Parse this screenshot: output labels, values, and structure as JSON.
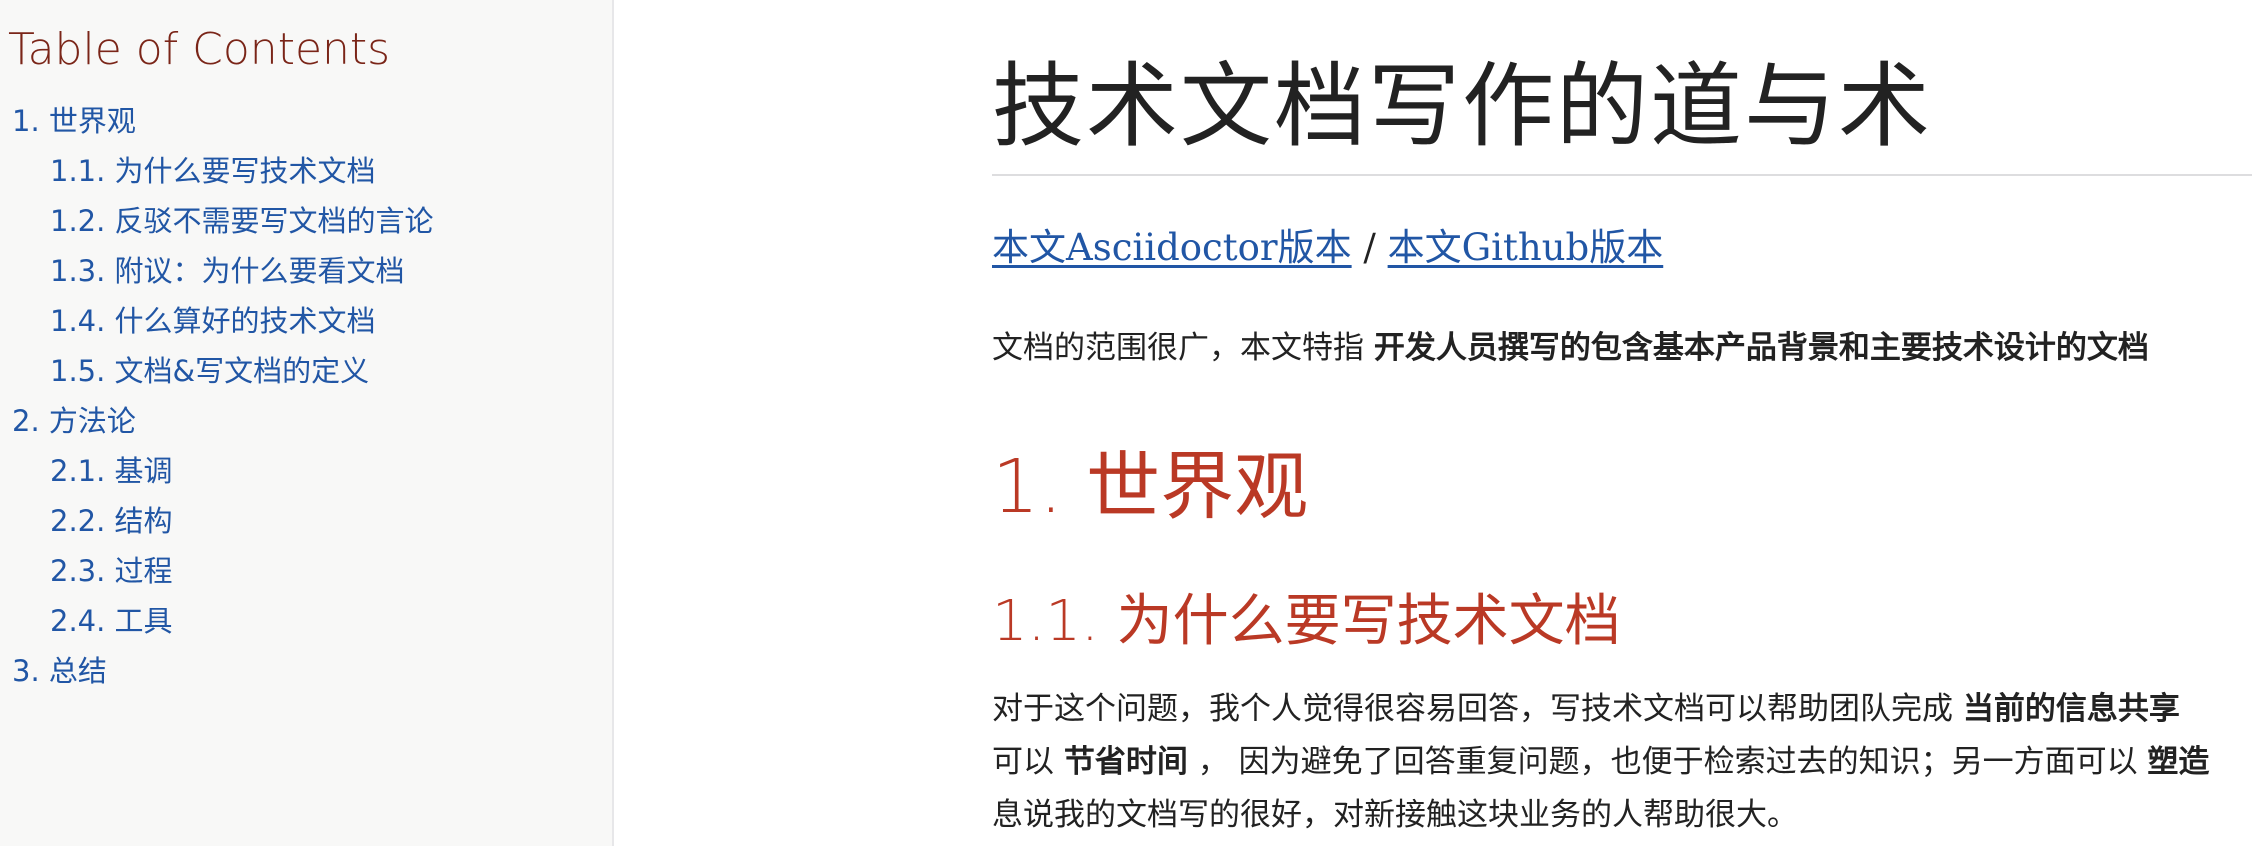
{
  "toc": {
    "title": "Table of Contents",
    "items": [
      {
        "label": "1. 世界观",
        "level": 1
      },
      {
        "label": "1.1. 为什么要写技术文档",
        "level": 2
      },
      {
        "label": "1.2. 反驳不需要写文档的言论",
        "level": 2
      },
      {
        "label": "1.3. 附议：为什么要看文档",
        "level": 2
      },
      {
        "label": "1.4. 什么算好的技术文档",
        "level": 2
      },
      {
        "label": "1.5. 文档&写文档的定义",
        "level": 2
      },
      {
        "label": "2. 方法论",
        "level": 1
      },
      {
        "label": "2.1. 基调",
        "level": 2
      },
      {
        "label": "2.2. 结构",
        "level": 2
      },
      {
        "label": "2.3. 过程",
        "level": 2
      },
      {
        "label": "2.4. 工具",
        "level": 2
      },
      {
        "label": "3. 总结",
        "level": 1
      }
    ]
  },
  "doc": {
    "title": "技术文档写作的道与术",
    "links": {
      "asciidoctor": "本文Asciidoctor版本",
      "separator": " / ",
      "github": "本文Github版本"
    },
    "intro": {
      "text": "文档的范围很广，本文特指 ",
      "strong": "开发人员撰写的包含基本产品背景和主要技术设计的文档"
    },
    "section1": {
      "heading": "1. 世界观"
    },
    "section1_1": {
      "heading": "1.1. 为什么要写技术文档",
      "line1_text": "对于这个问题，我个人觉得很容易回答，写技术文档可以帮助团队完成 ",
      "line1_strong": "当前的信息共享",
      "line2_a": "可以 ",
      "line2_strong1": "节省时间",
      "line2_b": " ， 因为避免了回答重复问题，也便于检索过去的知识；另一方面可以 ",
      "line2_strong2": "塑造",
      "line3": "息说我的文档写的很好，对新接触这块业务的人帮助很大。"
    }
  }
}
